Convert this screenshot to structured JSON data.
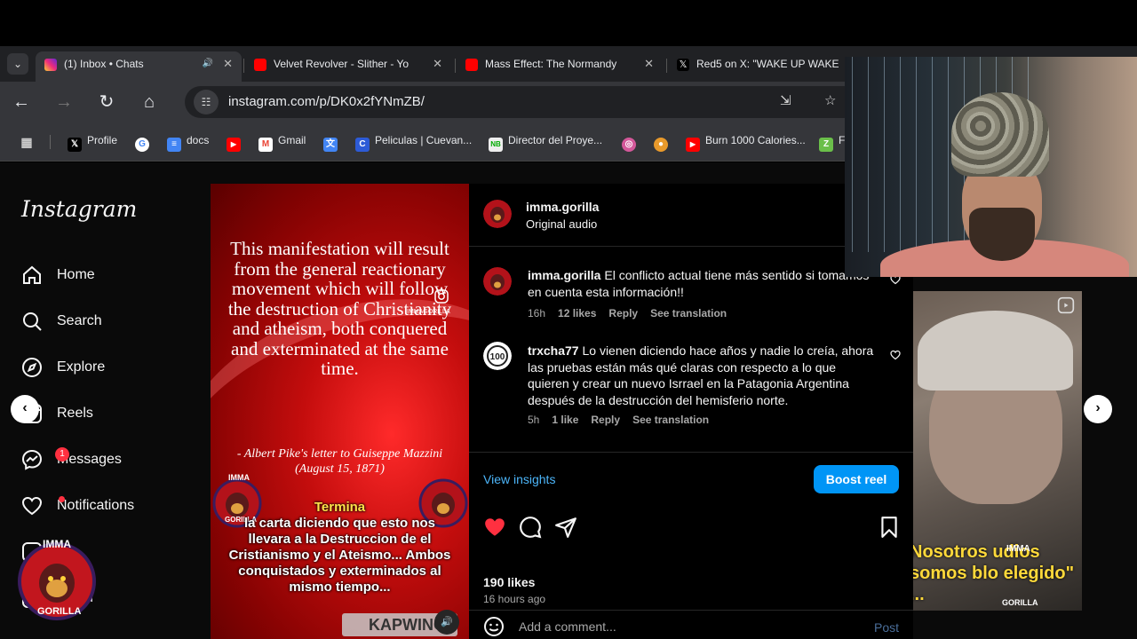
{
  "browser": {
    "tabs": [
      {
        "title": "(1) Inbox • Chats",
        "active": true,
        "favicon": "instagram-icon"
      },
      {
        "title": "Velvet Revolver - Slither - Yo",
        "active": false,
        "favicon": "youtube-icon"
      },
      {
        "title": "Mass Effect: The Normandy",
        "active": false,
        "favicon": "youtube-icon"
      },
      {
        "title": "Red5 on X: \"WAKE UP WAKE",
        "active": false,
        "favicon": "x-icon"
      }
    ],
    "url": "instagram.com/p/DK0x2fYNmZB/",
    "bookmarks": [
      {
        "label": "",
        "icon": "apps-grid-icon"
      },
      {
        "label": "Profile",
        "icon": "x-icon"
      },
      {
        "label": "",
        "icon": "google-icon"
      },
      {
        "label": "docs",
        "icon": "docs-icon"
      },
      {
        "label": "",
        "icon": "youtube-icon"
      },
      {
        "label": "Gmail",
        "icon": "gmail-icon"
      },
      {
        "label": "",
        "icon": "translate-icon"
      },
      {
        "label": "Peliculas | Cuevan...",
        "icon": "cuevana-icon"
      },
      {
        "label": "Director del Proye...",
        "icon": "nb-icon"
      },
      {
        "label": "",
        "icon": "donut-icon"
      },
      {
        "label": "",
        "icon": "cookie-icon"
      },
      {
        "label": "Burn 1000 Calories...",
        "icon": "youtube-icon"
      },
      {
        "label": "F",
        "icon": "fz-icon"
      }
    ]
  },
  "instagram": {
    "logo": "Instagram",
    "nav": [
      {
        "label": "Home",
        "icon": "home-icon"
      },
      {
        "label": "Search",
        "icon": "search-icon"
      },
      {
        "label": "Explore",
        "icon": "explore-icon"
      },
      {
        "label": "Reels",
        "icon": "reels-icon"
      },
      {
        "label": "Messages",
        "icon": "messenger-icon",
        "badge": "1"
      },
      {
        "label": "Notifications",
        "icon": "heart-icon"
      },
      {
        "label": "te",
        "icon": "create-icon"
      },
      {
        "label": "board",
        "icon": "dashboard-icon"
      }
    ],
    "reel": {
      "quote": "This manifestation will result from the general reactionary movement which will follow the destruction of Christianity and atheism, both conquered and exterminated at the same time.",
      "author": "- Albert Pike's letter to Guiseppe Mazzini (August 15, 1871)",
      "caption_first": "Termina",
      "caption_rest": "la carta diciendo que esto nos llevara a la Destruccion de el Cristianismo y el Ateismo... Ambos conquistados y exterminados al mismo tiempo...",
      "watermark_handle": "IMMAGORILLA",
      "badge_text_top": "IMMA",
      "badge_text_bottom": "GORILLA",
      "kapwing": "KAPWING"
    },
    "post": {
      "username": "imma.gorilla",
      "audio": "Original audio",
      "comments": [
        {
          "user": "imma.gorilla",
          "text": "El conflicto actual tiene más sentido si tomamos en cuenta esta información!!",
          "time": "16h",
          "likes": "12 likes",
          "reply": "Reply",
          "translate": "See translation"
        },
        {
          "user": "trxcha77",
          "text": "Lo vienen diciendo hace años y nadie lo creía, ahora las pruebas están más qué claras con respecto a lo que quieren y crear un nuevo Isrrael en la Patagonia Argentina después de la destrucción del hemisferio norte.",
          "time": "5h",
          "likes": "1 like",
          "reply": "Reply",
          "translate": "See translation"
        }
      ],
      "view_insights": "View insights",
      "boost": "Boost reel",
      "likes": "190 likes",
      "time_ago": "16 hours ago",
      "comment_placeholder": "Add a comment...",
      "post_button": "Post"
    },
    "next_reel": {
      "caption": "Nosotros udios somos blo elegido\" ...",
      "badge_top": "IMMA",
      "badge_bottom": "GORILLA"
    },
    "sidebar_badge": {
      "top": "IMMA",
      "bottom": "GORILLA"
    }
  },
  "colors": {
    "accent_blue": "#0095f6",
    "link_blue": "#4cb5f9",
    "like_red": "#ff3040",
    "reel_red": "#c40d0d"
  }
}
